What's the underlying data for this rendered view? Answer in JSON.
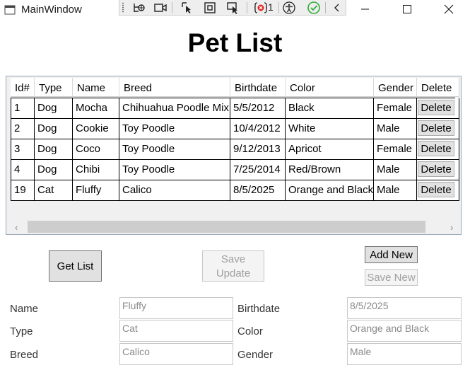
{
  "window": {
    "title": "MainWindow",
    "debug_counter": "1"
  },
  "page": {
    "title": "Pet List"
  },
  "grid": {
    "columns": [
      "Id#",
      "Type",
      "Name",
      "Breed",
      "Birthdate",
      "Color",
      "Gender",
      "Delete"
    ],
    "rows": [
      {
        "id": "1",
        "type": "Dog",
        "name": "Mocha",
        "breed": "Chihuahua Poodle Mix",
        "birthdate": "5/5/2012",
        "color": "Black",
        "gender": "Female"
      },
      {
        "id": "2",
        "type": "Dog",
        "name": "Cookie",
        "breed": "Toy Poodle",
        "birthdate": "10/4/2012",
        "color": "White",
        "gender": "Male"
      },
      {
        "id": "3",
        "type": "Dog",
        "name": "Coco",
        "breed": "Toy Poodle",
        "birthdate": "9/12/2013",
        "color": "Apricot",
        "gender": "Female"
      },
      {
        "id": "4",
        "type": "Dog",
        "name": "Chibi",
        "breed": "Toy Poodle",
        "birthdate": "7/25/2014",
        "color": "Red/Brown",
        "gender": "Male"
      },
      {
        "id": "19",
        "type": "Cat",
        "name": "Fluffy",
        "breed": "Calico",
        "birthdate": "8/5/2025",
        "color": "Orange and Black",
        "gender": "Male"
      }
    ],
    "delete_label": "Delete"
  },
  "buttons": {
    "get_list": "Get List",
    "save_update": "Save Update",
    "add_new": "Add New",
    "save_new": "Save New"
  },
  "form": {
    "name_label": "Name",
    "name_value": "Fluffy",
    "type_label": "Type",
    "type_value": "Cat",
    "breed_label": "Breed",
    "breed_value": "Calico",
    "birthdate_label": "Birthdate",
    "birthdate_value": "8/5/2025",
    "color_label": "Color",
    "color_value": "Orange and Black",
    "gender_label": "Gender",
    "gender_value": "Male"
  },
  "colors": {
    "grid_border": "#9aa8b8",
    "button_face": "#e1e1e1",
    "check_green": "#2fae3a",
    "error_red": "#e02424"
  }
}
